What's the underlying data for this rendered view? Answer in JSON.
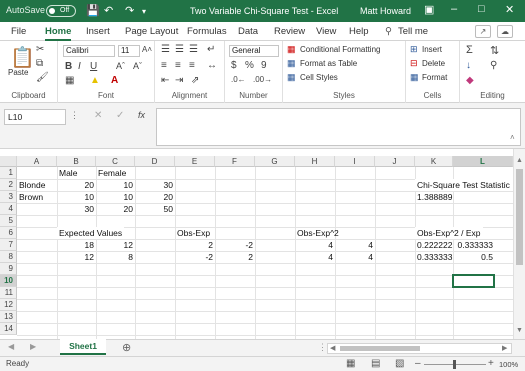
{
  "titlebar": {
    "autosave_label": "AutoSave",
    "autosave_state": "Off",
    "document_title": "Two Variable Chi-Square Test  -  Excel",
    "user_name": "Matt Howard"
  },
  "ribbon_tabs": [
    "File",
    "Home",
    "Insert",
    "Page Layout",
    "Formulas",
    "Data",
    "Review",
    "View",
    "Help",
    "Tell me"
  ],
  "ribbon": {
    "paste_label": "Paste",
    "font_name": "Calibri",
    "font_size": "11",
    "number_format": "General",
    "conditional_formatting": "Conditional Formatting",
    "format_as_table": "Format as Table",
    "cell_styles": "Cell Styles",
    "insert": "Insert",
    "delete": "Delete",
    "format": "Format",
    "groups": [
      "Clipboard",
      "Font",
      "Alignment",
      "Number",
      "Styles",
      "Cells",
      "Editing"
    ]
  },
  "formula_bar": {
    "name_box": "L10",
    "fx_label": "fx",
    "content": ""
  },
  "columns": [
    "A",
    "B",
    "C",
    "D",
    "E",
    "F",
    "G",
    "H",
    "I",
    "J",
    "K",
    "L"
  ],
  "rows": [
    "1",
    "2",
    "3",
    "4",
    "5",
    "6",
    "7",
    "8",
    "9",
    "10",
    "11",
    "12",
    "13",
    "14"
  ],
  "cells": {
    "B1": "Male",
    "C1": "Female",
    "A2": "Blonde",
    "B2": "20",
    "C2": "10",
    "D2": "30",
    "K2": "Chi-Square Test Statistic",
    "A3": "Brown",
    "B3": "10",
    "C3": "10",
    "D3": "20",
    "K3": "1.388889",
    "B4": "30",
    "C4": "20",
    "D4": "50",
    "B6": "Expected Values",
    "E6": "Obs-Exp",
    "H6": "Obs-Exp^2",
    "K6": "Obs-Exp^2 / Exp",
    "B7": "18",
    "C7": "12",
    "E7": "2",
    "F7": "-2",
    "H7": "4",
    "I7": "4",
    "K7": "0.222222",
    "L7": "0.333333",
    "B8": "12",
    "C8": "8",
    "E8": "-2",
    "F8": "2",
    "H8": "4",
    "I8": "4",
    "K8": "0.333333",
    "L8": "0.5"
  },
  "sheet_tabs": [
    "Sheet1"
  ],
  "status": {
    "ready": "Ready",
    "zoom": "100%"
  },
  "colors": {
    "excel_green": "#217346"
  }
}
